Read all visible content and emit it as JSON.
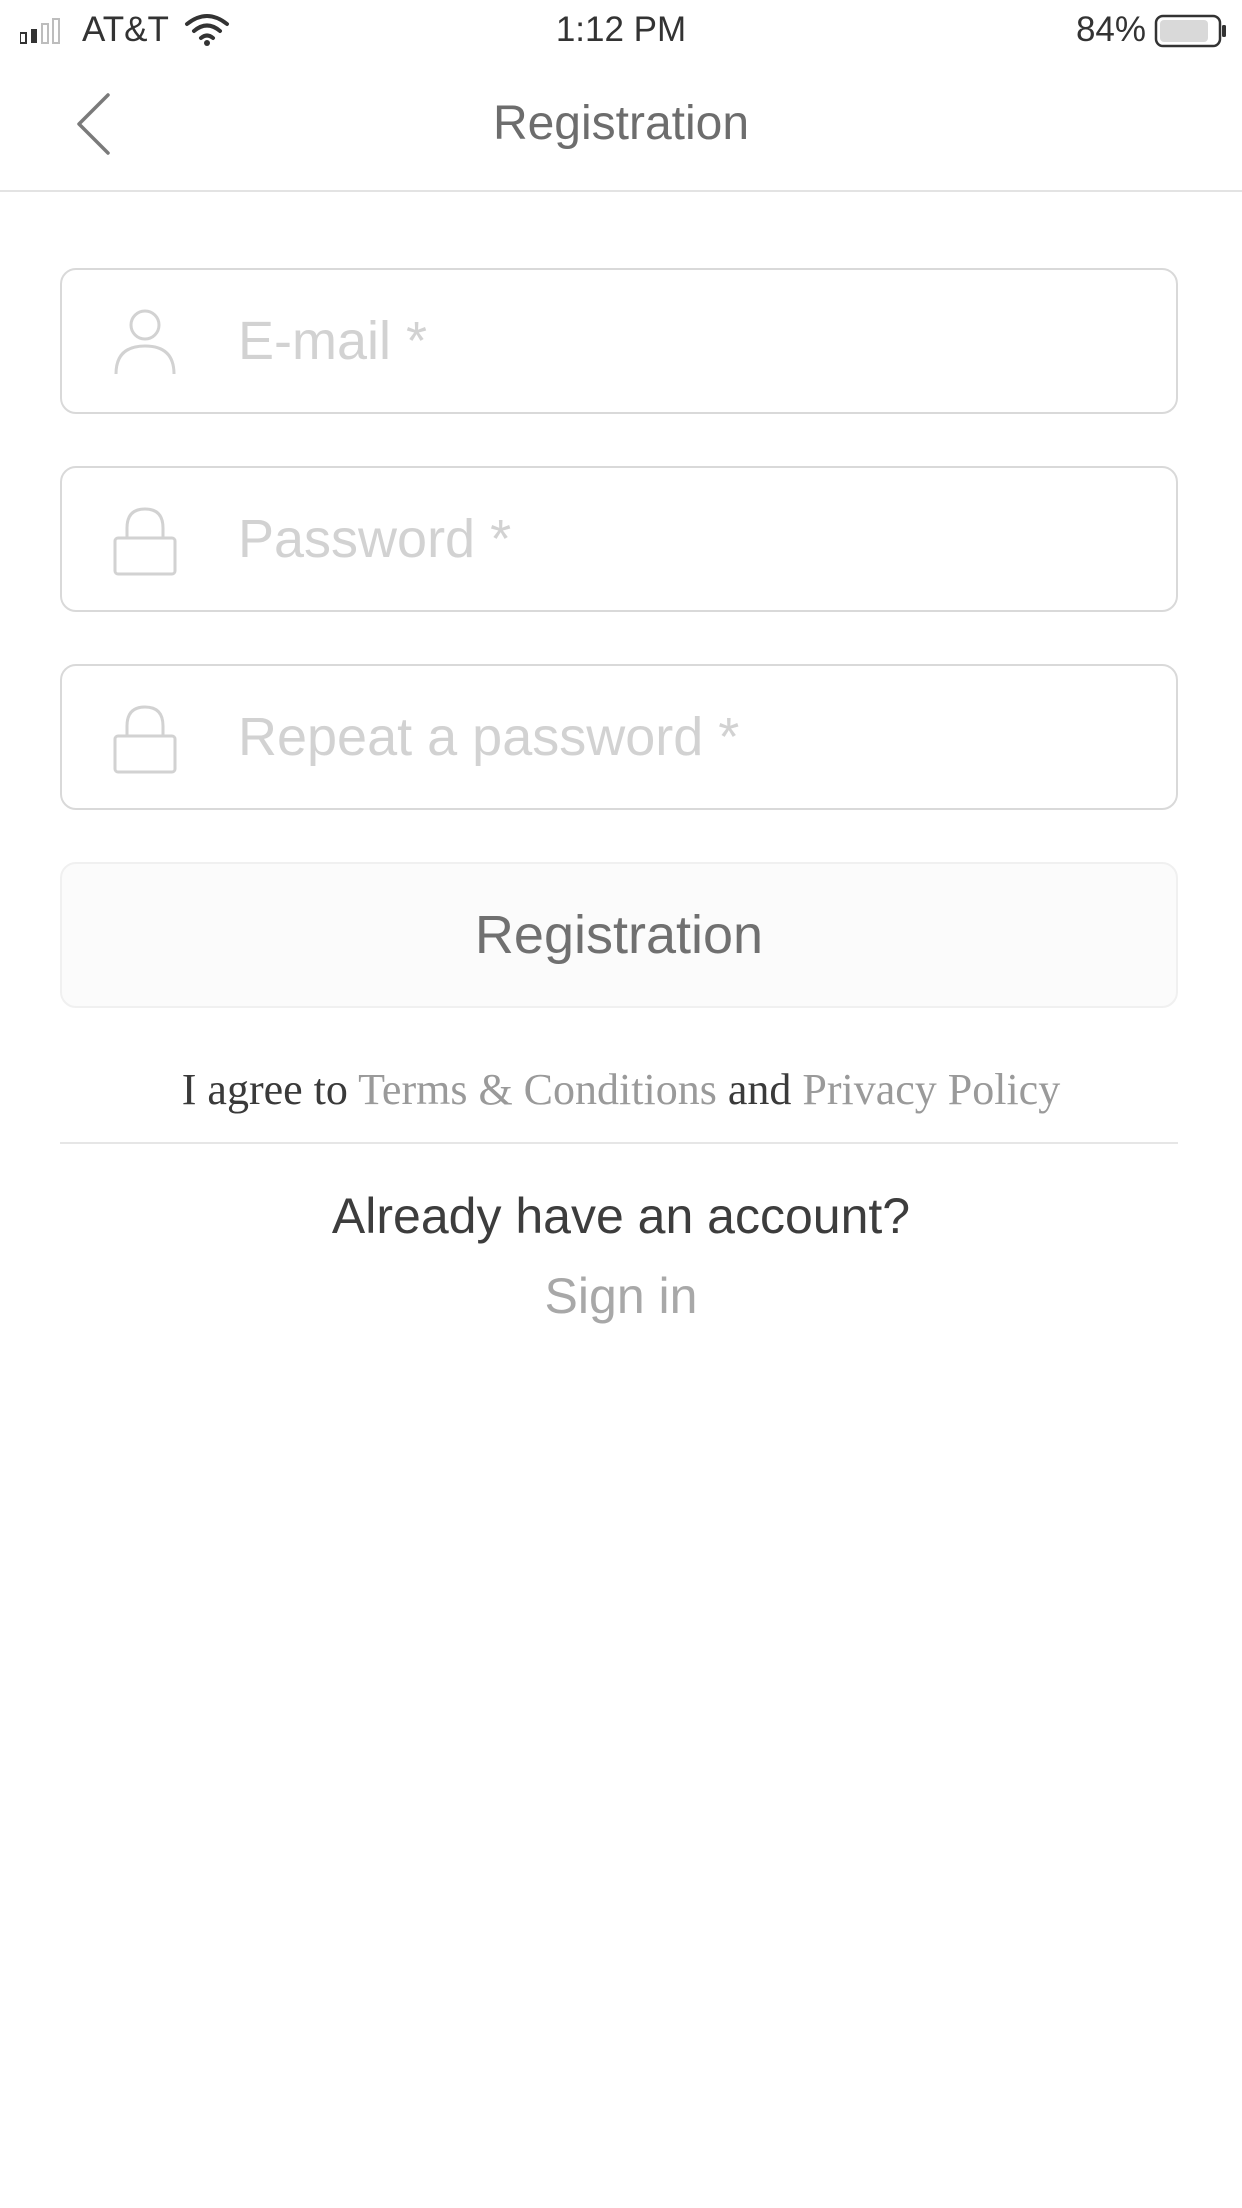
{
  "status_bar": {
    "carrier": "AT&T",
    "time": "1:12 PM",
    "battery_percent": "84%",
    "battery_level": 0.84,
    "icons": [
      "signal-icon",
      "wifi-icon",
      "battery-icon"
    ]
  },
  "nav": {
    "title": "Registration",
    "back_icon": "chevron-left-icon"
  },
  "form": {
    "email": {
      "placeholder": "E-mail *",
      "value": "",
      "icon": "user-icon"
    },
    "password": {
      "placeholder": "Password *",
      "value": "",
      "icon": "lock-icon"
    },
    "repeat_password": {
      "placeholder": "Repeat a password *",
      "value": "",
      "icon": "lock-icon"
    },
    "submit_label": "Registration"
  },
  "agreement": {
    "prefix": "I agree to",
    "terms_link": "Terms & Conditions",
    "conjunction": "and",
    "privacy_link": "Privacy Policy"
  },
  "footer": {
    "question": "Already have an account?",
    "sign_in_link": "Sign in"
  },
  "colors": {
    "text": "#333333",
    "muted_link": "#9a9a9a",
    "placeholder": "#d2d2d2",
    "border": "#d9d9d9"
  }
}
